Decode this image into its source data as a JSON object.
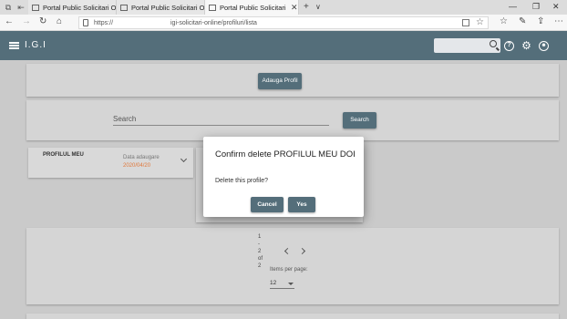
{
  "browser": {
    "tabs": [
      {
        "label": "Portal Public Solicitari Onlin",
        "active": false
      },
      {
        "label": "Portal Public Solicitari Onlin",
        "active": false
      },
      {
        "label": "Portal Public Solicitari C",
        "active": true
      }
    ],
    "url_protocol": "https://",
    "url_path": "igi-solicitari-online/profiluri/lista"
  },
  "app": {
    "title": "I.G.I",
    "accent_color": "#546e7a",
    "header_icons": [
      "search-icon",
      "help-icon",
      "gear-icon",
      "account-icon"
    ]
  },
  "main": {
    "add_profile_button": "Adauga Profil",
    "search_label": "Search",
    "search_button": "Search",
    "profile_card": {
      "name": "PROFILUL MEU",
      "date_label": "Data adaugare",
      "date_value": "2020/04/20",
      "date_color": "#e0773a"
    },
    "pagination": {
      "lines": [
        "1",
        "-",
        "2",
        "of",
        "2"
      ],
      "items_per_page_label": "Items per page:",
      "items_per_page_value": "12"
    }
  },
  "dialog": {
    "title": "Confirm delete PROFILUL MEU DOI",
    "message": "Delete this profile?",
    "cancel_label": "Cancel",
    "confirm_label": "Yes"
  }
}
